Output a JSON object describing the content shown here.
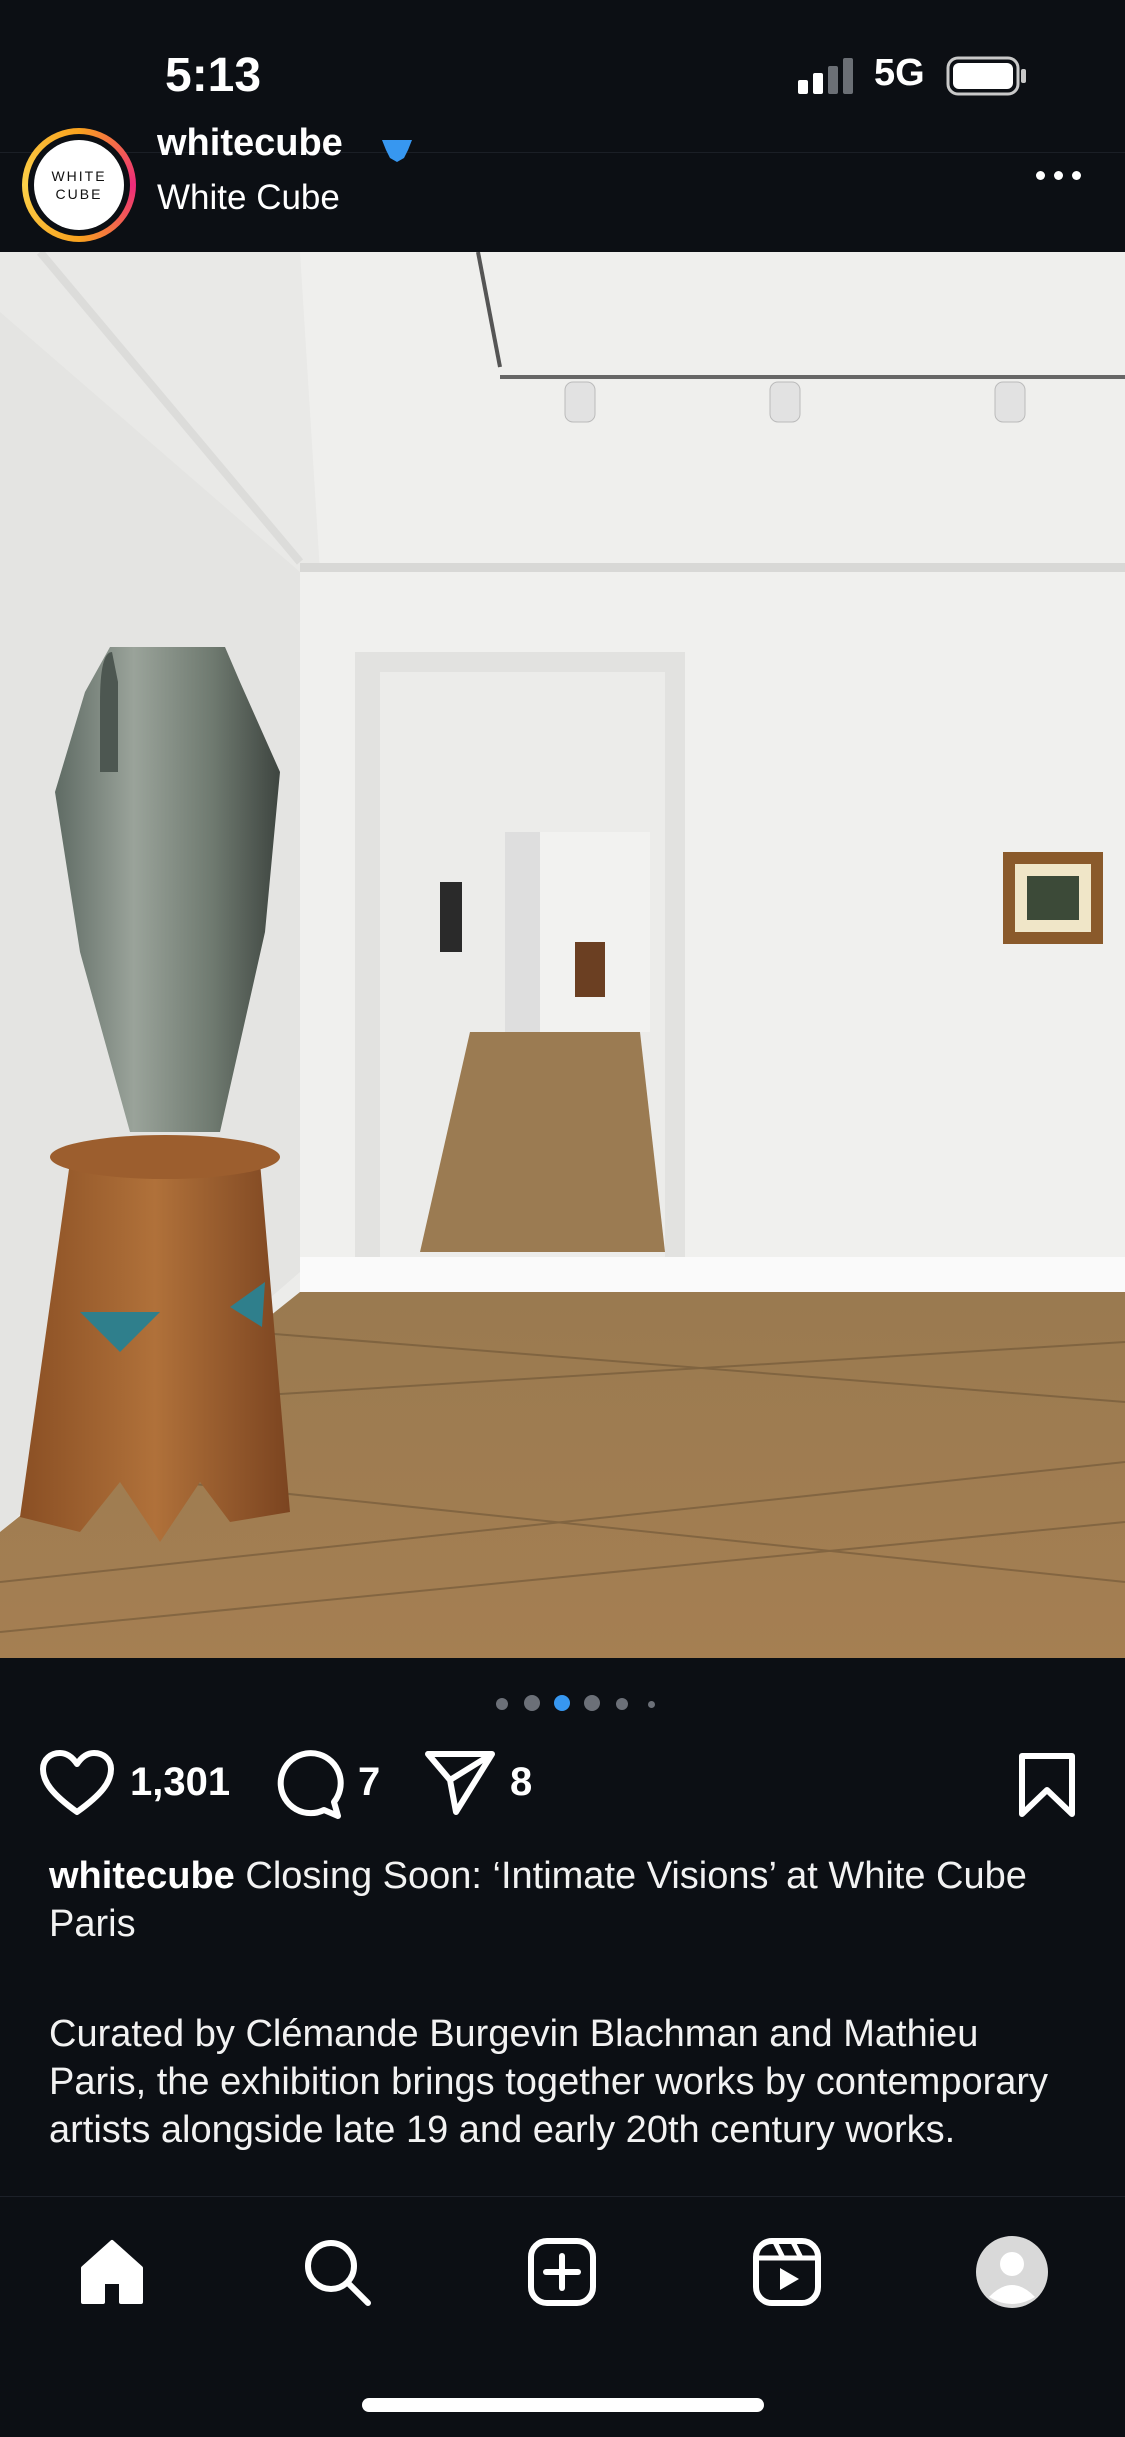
{
  "status_bar": {
    "time": "5:13",
    "network": "5G",
    "icons": [
      "signal-bars-icon",
      "battery-icon"
    ]
  },
  "post": {
    "username": "whitecube",
    "display_name": "White Cube",
    "avatar_logo_line1": "WHITE",
    "avatar_logo_line2": "CUBE",
    "verified": true,
    "more_icon": "more-horizontal-icon",
    "carousel": {
      "total": 6,
      "active_index": 2
    },
    "actions": {
      "likes": "1,301",
      "comments": "7",
      "shares": "8"
    },
    "caption": {
      "username": "whitecube",
      "title": " Closing Soon: ‘Intimate Visions’ at White Cube Paris",
      "body": "Curated by Clémande Burgevin Blachman and Mathieu Paris, the exhibition brings together works by contemporary artists alongside late 19 and early 20th century works."
    }
  },
  "bottom_nav": {
    "items": [
      "home-icon",
      "search-icon",
      "create-icon",
      "reels-icon",
      "profile-icon"
    ]
  },
  "colors": {
    "background": "#0c0f14",
    "accent_blue": "#3797f0",
    "text": "#f5f5f5"
  }
}
